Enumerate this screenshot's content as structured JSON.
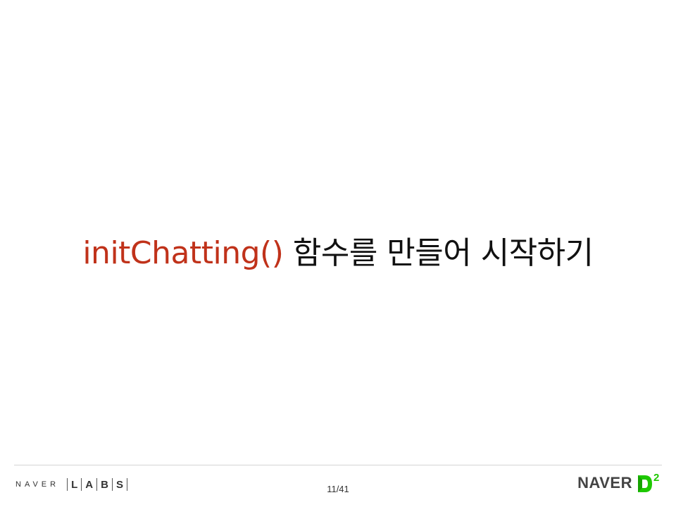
{
  "slide": {
    "title_code": "initChatting()",
    "title_text": "함수를 만들어 시작하기"
  },
  "footer": {
    "left_brand": "NAVER",
    "labs_letters": [
      "L",
      "A",
      "B",
      "S"
    ],
    "page_number": "11/41",
    "right_brand": "NAVER",
    "right_logo_superscript": "2"
  },
  "colors": {
    "code_red": "#c0321a",
    "text_dark": "#111111",
    "logo_green": "#1ec800",
    "logo_gray": "#444444"
  },
  "icons": {
    "right_logo": "naver-d2-logo"
  }
}
